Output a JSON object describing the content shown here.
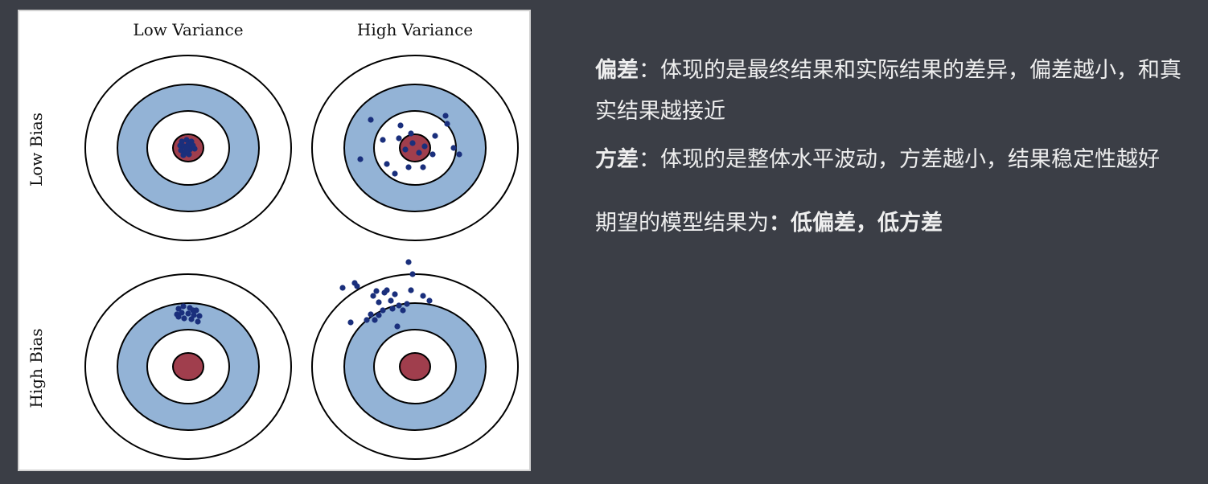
{
  "figure": {
    "columns": [
      "Low Variance",
      "High Variance"
    ],
    "rows": [
      "Low Bias",
      "High Bias"
    ],
    "colors": {
      "ring_outer": "#ffffff",
      "ring_blue": "#93b3d6",
      "ring_inner": "#ffffff",
      "bullseye": "#a03e4d",
      "dots": "#1a2f7c",
      "stroke": "#000000"
    },
    "shots": [
      {
        "target": "low-bias-low-variance",
        "dots": [
          [
            -8,
            -8
          ],
          [
            -2,
            -10
          ],
          [
            4,
            -8
          ],
          [
            -10,
            -3
          ],
          [
            -5,
            -2
          ],
          [
            0,
            -4
          ],
          [
            6,
            -3
          ],
          [
            -9,
            3
          ],
          [
            -4,
            5
          ],
          [
            2,
            2
          ],
          [
            8,
            1
          ],
          [
            -6,
            9
          ],
          [
            1,
            8
          ],
          [
            -2,
            -1
          ]
        ]
      },
      {
        "target": "low-bias-high-variance",
        "dots": [
          [
            -55,
            -35
          ],
          [
            -40,
            -10
          ],
          [
            -18,
            -28
          ],
          [
            -20,
            -12
          ],
          [
            -5,
            -18
          ],
          [
            -12,
            2
          ],
          [
            -35,
            20
          ],
          [
            -68,
            14
          ],
          [
            -25,
            32
          ],
          [
            -8,
            24
          ],
          [
            5,
            6
          ],
          [
            12,
            -2
          ],
          [
            22,
            8
          ],
          [
            10,
            24
          ],
          [
            25,
            -15
          ],
          [
            40,
            -30
          ],
          [
            48,
            0
          ],
          [
            55,
            8
          ],
          [
            -3,
            -6
          ],
          [
            38,
            -40
          ]
        ]
      },
      {
        "target": "high-bias-low-variance",
        "dots": [
          [
            -12,
            -72
          ],
          [
            -6,
            -75
          ],
          [
            2,
            -73
          ],
          [
            10,
            -70
          ],
          [
            -14,
            -65
          ],
          [
            -8,
            -67
          ],
          [
            0,
            -66
          ],
          [
            7,
            -64
          ],
          [
            14,
            -63
          ],
          [
            -5,
            -60
          ],
          [
            4,
            -59
          ],
          [
            12,
            -56
          ],
          [
            -12,
            -62
          ],
          [
            6,
            -70
          ]
        ]
      },
      {
        "target": "high-bias-high-variance",
        "dots": [
          [
            -90,
            -98
          ],
          [
            -75,
            -104
          ],
          [
            -72,
            -100
          ],
          [
            -48,
            -94
          ],
          [
            -38,
            -92
          ],
          [
            -52,
            -88
          ],
          [
            -45,
            -80
          ],
          [
            -30,
            -82
          ],
          [
            -40,
            -70
          ],
          [
            -25,
            -90
          ],
          [
            -20,
            -76
          ],
          [
            -15,
            -70
          ],
          [
            -10,
            -78
          ],
          [
            -5,
            -95
          ],
          [
            -3,
            -115
          ],
          [
            -8,
            -130
          ],
          [
            10,
            -88
          ],
          [
            18,
            -82
          ],
          [
            -60,
            -58
          ],
          [
            -55,
            -65
          ],
          [
            -50,
            -58
          ],
          [
            -45,
            -64
          ],
          [
            -22,
            -50
          ],
          [
            -80,
            -55
          ],
          [
            -35,
            -95
          ],
          [
            -28,
            -72
          ]
        ]
      }
    ]
  },
  "text": {
    "bias_term": "偏差",
    "bias_text": "：体现的是最终结果和实际结果的差异，偏差越小，和真实结果越接近",
    "variance_term": "方差",
    "variance_text": "：体现的是整体水平波动，方差越小，结果稳定性越好",
    "expect_prefix": "期望的模型结果为",
    "expect_value": "：低偏差，低方差"
  }
}
